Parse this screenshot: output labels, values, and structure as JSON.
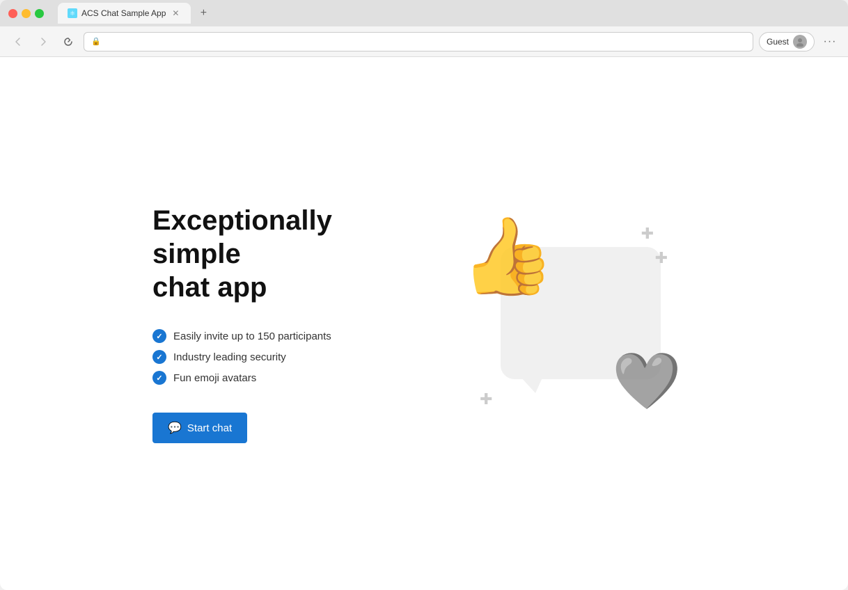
{
  "browser": {
    "tab_title": "ACS Chat Sample App",
    "tab_favicon": "⚛",
    "address_bar_text": "",
    "profile_label": "Guest",
    "nav": {
      "back": "←",
      "forward": "→",
      "refresh": "↻",
      "more": "···"
    }
  },
  "page": {
    "headline_line1": "Exceptionally simple",
    "headline_line2": "chat app",
    "features": [
      "Easily invite up to 150 participants",
      "Industry leading security",
      "Fun emoji avatars"
    ],
    "cta_button": "Start chat",
    "chat_icon": "💬"
  }
}
